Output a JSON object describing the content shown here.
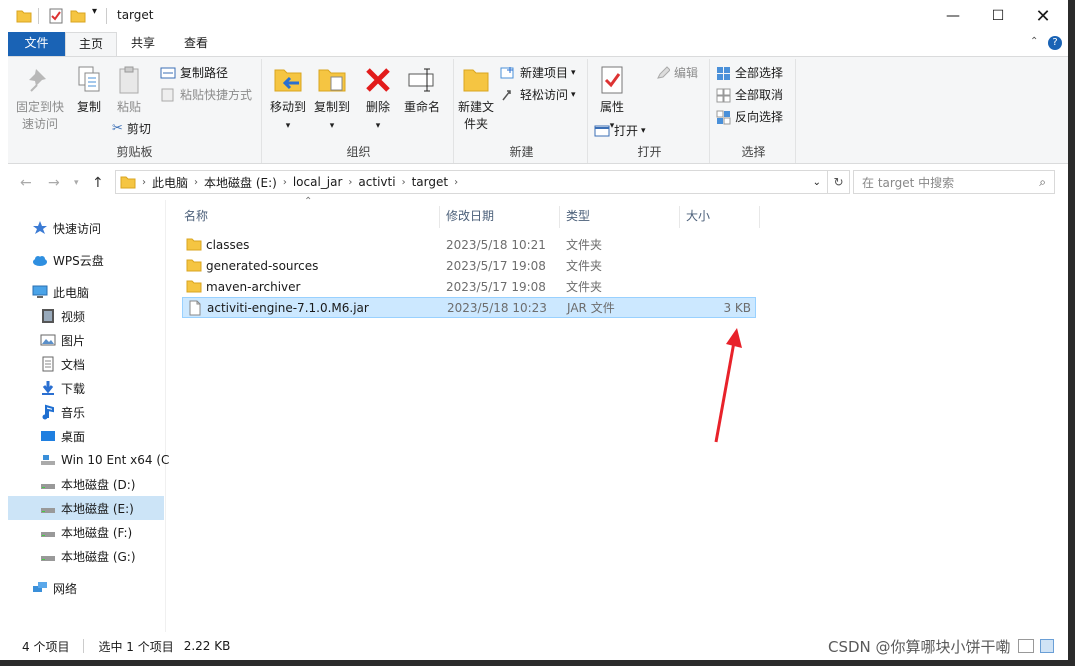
{
  "window": {
    "title": "target"
  },
  "tabs": [
    "文件",
    "主页",
    "共享",
    "查看"
  ],
  "ribbon": {
    "clipboard": {
      "pin": "固定到快速访问",
      "copy": "复制",
      "paste": "粘贴",
      "copy_path": "复制路径",
      "paste_shortcut": "粘贴快捷方式",
      "cut": "剪切",
      "label": "剪贴板"
    },
    "organize": {
      "move_to": "移动到",
      "copy_to": "复制到",
      "delete": "删除",
      "rename": "重命名",
      "label": "组织"
    },
    "new": {
      "new_folder": "新建文件夹",
      "new_item": "新建项目",
      "easy_access": "轻松访问",
      "label": "新建"
    },
    "open": {
      "properties": "属性",
      "open": "打开",
      "edit": "编辑",
      "label": "打开"
    },
    "select": {
      "select_all": "全部选择",
      "select_none": "全部取消",
      "invert": "反向选择",
      "label": "选择"
    }
  },
  "address": {
    "crumbs": [
      "此电脑",
      "本地磁盘 (E:)",
      "local_jar",
      "activti",
      "target"
    ],
    "search_placeholder": "在 target 中搜索"
  },
  "sidebar": [
    {
      "label": "快速访问",
      "icon": "star-icon"
    },
    {
      "label": "WPS云盘",
      "icon": "cloud-icon"
    },
    {
      "label": "此电脑",
      "icon": "computer-icon"
    },
    {
      "label": "视频",
      "icon": "video-icon"
    },
    {
      "label": "图片",
      "icon": "picture-icon"
    },
    {
      "label": "文档",
      "icon": "document-icon"
    },
    {
      "label": "下载",
      "icon": "download-icon"
    },
    {
      "label": "音乐",
      "icon": "music-icon"
    },
    {
      "label": "桌面",
      "icon": "desktop-icon"
    },
    {
      "label": "Win 10 Ent x64 (C",
      "icon": "system-drive-icon"
    },
    {
      "label": "本地磁盘 (D:)",
      "icon": "drive-icon"
    },
    {
      "label": "本地磁盘 (E:)",
      "icon": "drive-icon"
    },
    {
      "label": "本地磁盘 (F:)",
      "icon": "drive-icon"
    },
    {
      "label": "本地磁盘 (G:)",
      "icon": "drive-icon"
    },
    {
      "label": "网络",
      "icon": "network-icon"
    }
  ],
  "columns": {
    "name": "名称",
    "date": "修改日期",
    "type": "类型",
    "size": "大小"
  },
  "files": [
    {
      "name": "classes",
      "date": "2023/5/18 10:21",
      "type": "文件夹",
      "size": ""
    },
    {
      "name": "generated-sources",
      "date": "2023/5/17 19:08",
      "type": "文件夹",
      "size": ""
    },
    {
      "name": "maven-archiver",
      "date": "2023/5/17 19:08",
      "type": "文件夹",
      "size": ""
    },
    {
      "name": "activiti-engine-7.1.0.M6.jar",
      "date": "2023/5/18 10:23",
      "type": "JAR 文件",
      "size": "3 KB"
    }
  ],
  "status": {
    "count": "4 个项目",
    "selected": "选中 1 个项目",
    "size": "2.22 KB"
  },
  "watermark": "CSDN @你算哪块小饼干嘞",
  "colors": {
    "accent": "#1a63b5",
    "selection": "#cce8ff",
    "annotation": "#e8222a"
  }
}
